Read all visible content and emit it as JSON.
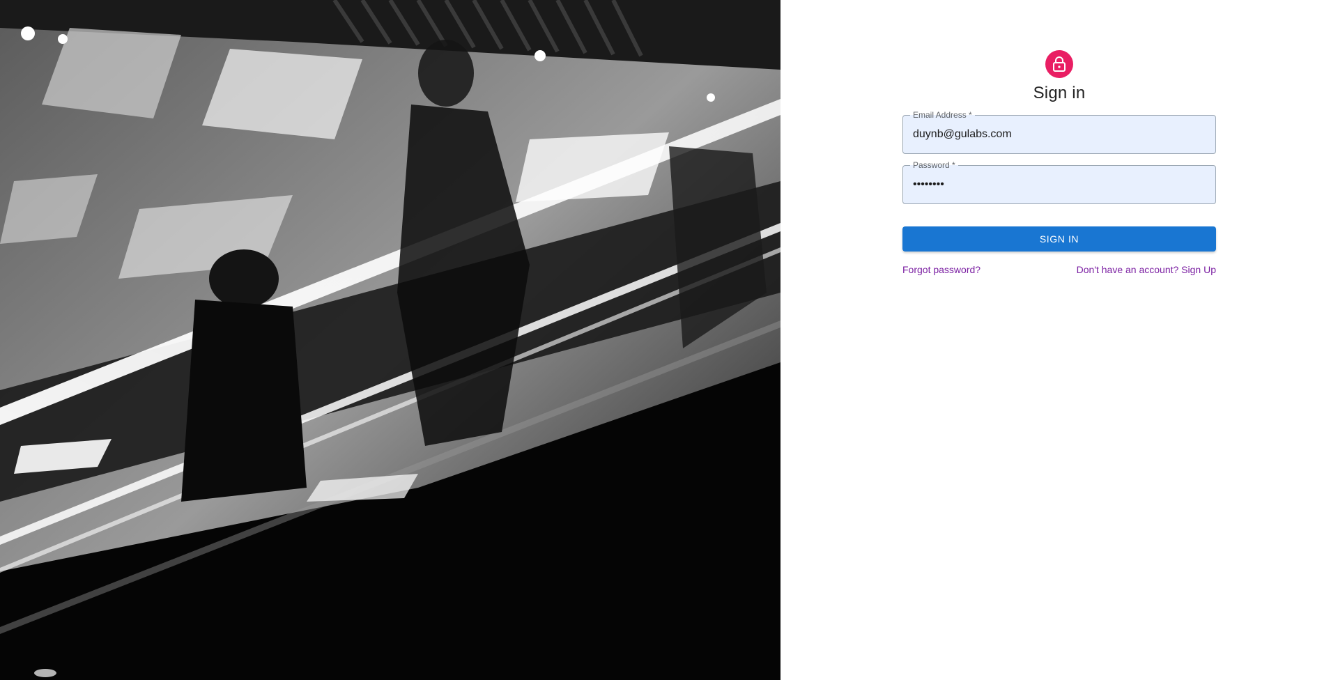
{
  "hero": {
    "description_icon": "escalator-photo"
  },
  "header": {
    "icon": "lock-icon",
    "title": "Sign in"
  },
  "form": {
    "email": {
      "label": "Email Address *",
      "value": "duynb@gulabs.com"
    },
    "password": {
      "label": "Password *",
      "value": "••••••••"
    },
    "submit_label": "SIGN IN"
  },
  "links": {
    "forgot": "Forgot password?",
    "signup": "Don't have an account? Sign Up"
  },
  "colors": {
    "accent": "#e91e63",
    "primary": "#1976d2",
    "link": "#7b1fa2",
    "autofill": "#e8f0fe"
  }
}
